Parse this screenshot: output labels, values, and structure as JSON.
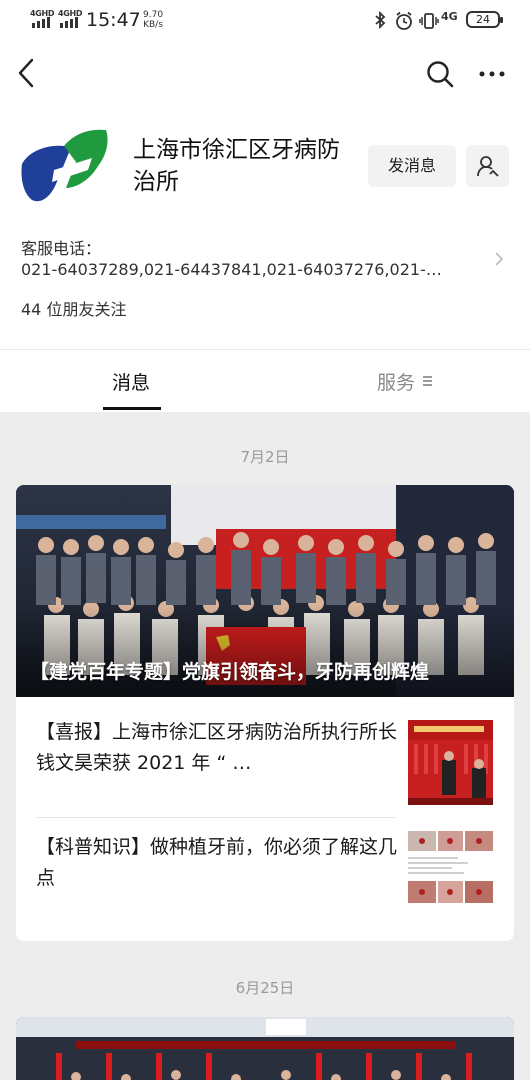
{
  "status_bar": {
    "sim1": "4GHD",
    "sim2": "4GHD",
    "time": "15:47",
    "net_speed_value": "9.70",
    "net_speed_unit": "KB/s",
    "network": "4G",
    "battery": "24"
  },
  "account": {
    "name": "上海市徐汇区牙病防治所",
    "send_message_label": "发消息",
    "phone_label": "客服电话：",
    "phone_value": "021-64037289,021-64437841,021-64037276,021-…",
    "followers": "44 位朋友关注"
  },
  "tabs": [
    {
      "label": "消息"
    },
    {
      "label": "服务"
    }
  ],
  "feed": {
    "groups": [
      {
        "date": "7月2日",
        "featured_title": "【建党百年专题】党旗引领奋斗，牙防再创辉煌",
        "articles": [
          {
            "title": "【喜报】上海市徐汇区牙病防治所执行所长钱文昊荣获 2021 年 “ …"
          },
          {
            "title": "【科普知识】做种植牙前，你必须了解这几点"
          }
        ]
      },
      {
        "date": "6月25日"
      }
    ]
  },
  "colors": {
    "logo_blue": "#1f3f99",
    "logo_green": "#1f9a3f",
    "flag_red": "#d81e1e",
    "feed_bg": "#ededed"
  }
}
